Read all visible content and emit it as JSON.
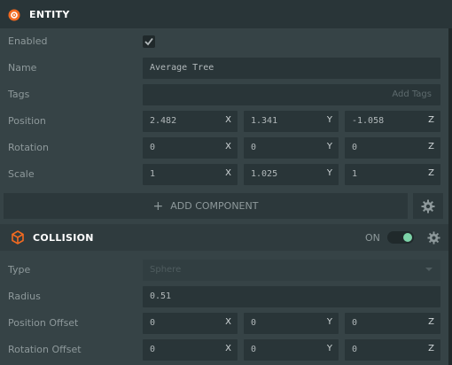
{
  "entity": {
    "title": "ENTITY",
    "enabled_label": "Enabled",
    "enabled": true,
    "name_label": "Name",
    "name_value": "Average Tree",
    "tags_label": "Tags",
    "tags_placeholder": "Add Tags",
    "position_label": "Position",
    "position": {
      "x": "2.482",
      "y": "1.341",
      "z": "-1.058"
    },
    "rotation_label": "Rotation",
    "rotation": {
      "x": "0",
      "y": "0",
      "z": "0"
    },
    "scale_label": "Scale",
    "scale": {
      "x": "1",
      "y": "1.025",
      "z": "1"
    },
    "add_component_label": "ADD COMPONENT"
  },
  "axes": {
    "x": "X",
    "y": "Y",
    "z": "Z"
  },
  "collision": {
    "title": "COLLISION",
    "toggle_label": "ON",
    "toggle_on": true,
    "type_label": "Type",
    "type_value": "Sphere",
    "radius_label": "Radius",
    "radius_value": "0.51",
    "position_offset_label": "Position Offset",
    "position_offset": {
      "x": "0",
      "y": "0",
      "z": "0"
    },
    "rotation_offset_label": "Rotation Offset",
    "rotation_offset": {
      "x": "0",
      "y": "0",
      "z": "0"
    }
  },
  "colors": {
    "panel_bg": "#364346",
    "field_bg": "#293538",
    "accent_orange": "#f26a21",
    "toggle_green": "#7dd3a8"
  },
  "icons": {
    "entity": "entity-icon",
    "collision": "cube-icon",
    "gear": "gear-icon",
    "check": "check-icon",
    "plus": "plus-icon",
    "chevron": "chevron-down-icon"
  }
}
